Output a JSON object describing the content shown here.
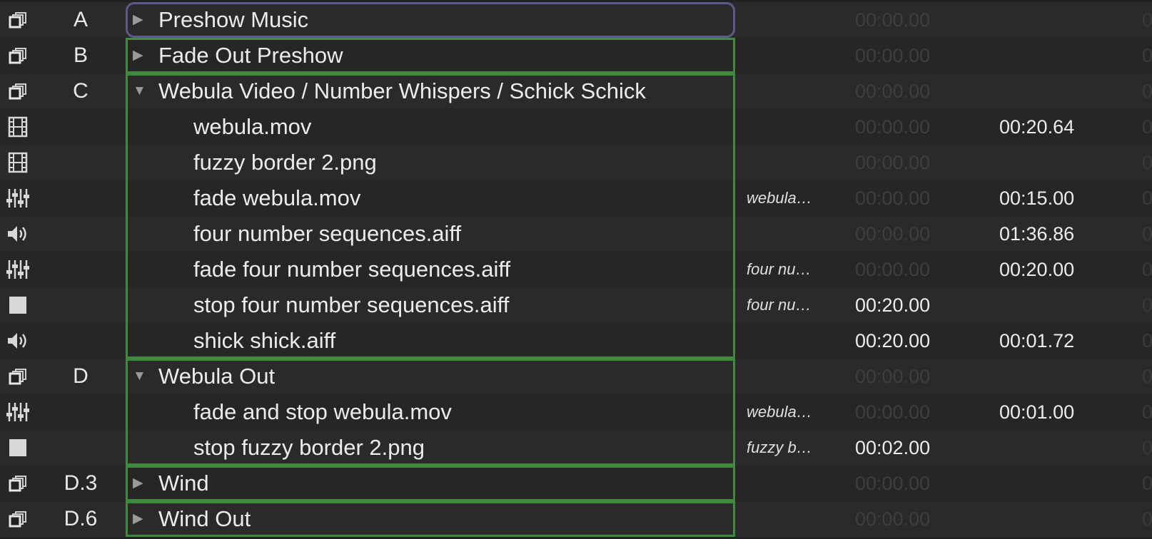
{
  "colors": {
    "group_border": "#3f8a3f",
    "selected_border": "#5a5a8c",
    "background": "#222222"
  },
  "cues": [
    {
      "icon": "group-icon",
      "number": "A",
      "name": "Preshow Music",
      "kind": "group",
      "expanded": false,
      "target": "",
      "prewait": "00:00.00",
      "prewait_dim": true,
      "action": "",
      "postwait": "0"
    },
    {
      "icon": "group-icon",
      "number": "B",
      "name": "Fade Out Preshow",
      "kind": "group",
      "expanded": false,
      "target": "",
      "prewait": "00:00.00",
      "prewait_dim": true,
      "action": "",
      "postwait": "0"
    },
    {
      "icon": "group-icon",
      "number": "C",
      "name": "Webula Video / Number Whispers / Schick Schick",
      "kind": "group",
      "expanded": true,
      "target": "",
      "prewait": "00:00.00",
      "prewait_dim": true,
      "action": "",
      "postwait": "0"
    },
    {
      "icon": "video-icon",
      "number": "",
      "name": "webula.mov",
      "kind": "child",
      "target": "",
      "prewait": "00:00.00",
      "prewait_dim": true,
      "action": "00:20.64",
      "postwait": "0"
    },
    {
      "icon": "video-icon",
      "number": "",
      "name": "fuzzy border 2.png",
      "kind": "child",
      "target": "",
      "prewait": "00:00.00",
      "prewait_dim": true,
      "action": "",
      "postwait": "0"
    },
    {
      "icon": "fade-icon",
      "number": "",
      "name": "fade webula.mov",
      "kind": "child",
      "target": "webula…",
      "prewait": "00:00.00",
      "prewait_dim": true,
      "action": "00:15.00",
      "postwait": "0"
    },
    {
      "icon": "audio-icon",
      "number": "",
      "name": "four number sequences.aiff",
      "kind": "child",
      "target": "",
      "prewait": "00:00.00",
      "prewait_dim": true,
      "action": "01:36.86",
      "postwait": "0"
    },
    {
      "icon": "fade-icon",
      "number": "",
      "name": "fade four number sequences.aiff",
      "kind": "child",
      "target": "four nu…",
      "prewait": "00:00.00",
      "prewait_dim": true,
      "action": "00:20.00",
      "postwait": "0"
    },
    {
      "icon": "stop-icon",
      "number": "",
      "name": "stop four number sequences.aiff",
      "kind": "child",
      "target": "four nu…",
      "prewait": "00:20.00",
      "prewait_dim": false,
      "action": "",
      "postwait": "0"
    },
    {
      "icon": "audio-icon",
      "number": "",
      "name": "shick shick.aiff",
      "kind": "child",
      "target": "",
      "prewait": "00:20.00",
      "prewait_dim": false,
      "action": "00:01.72",
      "postwait": "0"
    },
    {
      "icon": "group-icon",
      "number": "D",
      "name": "Webula Out",
      "kind": "group",
      "expanded": true,
      "target": "",
      "prewait": "00:00.00",
      "prewait_dim": true,
      "action": "",
      "postwait": "0"
    },
    {
      "icon": "fade-icon",
      "number": "",
      "name": "fade and stop webula.mov",
      "kind": "child",
      "target": "webula…",
      "prewait": "00:00.00",
      "prewait_dim": true,
      "action": "00:01.00",
      "postwait": "0"
    },
    {
      "icon": "stop-icon",
      "number": "",
      "name": "stop fuzzy border 2.png",
      "kind": "child",
      "target": "fuzzy b…",
      "prewait": "00:02.00",
      "prewait_dim": false,
      "action": "",
      "postwait": "0"
    },
    {
      "icon": "group-icon",
      "number": "D.3",
      "name": "Wind",
      "kind": "group",
      "expanded": false,
      "target": "",
      "prewait": "00:00.00",
      "prewait_dim": true,
      "action": "",
      "postwait": "0"
    },
    {
      "icon": "group-icon",
      "number": "D.6",
      "name": "Wind Out",
      "kind": "group",
      "expanded": false,
      "target": "",
      "prewait": "00:00.00",
      "prewait_dim": true,
      "action": "",
      "postwait": "0"
    }
  ]
}
